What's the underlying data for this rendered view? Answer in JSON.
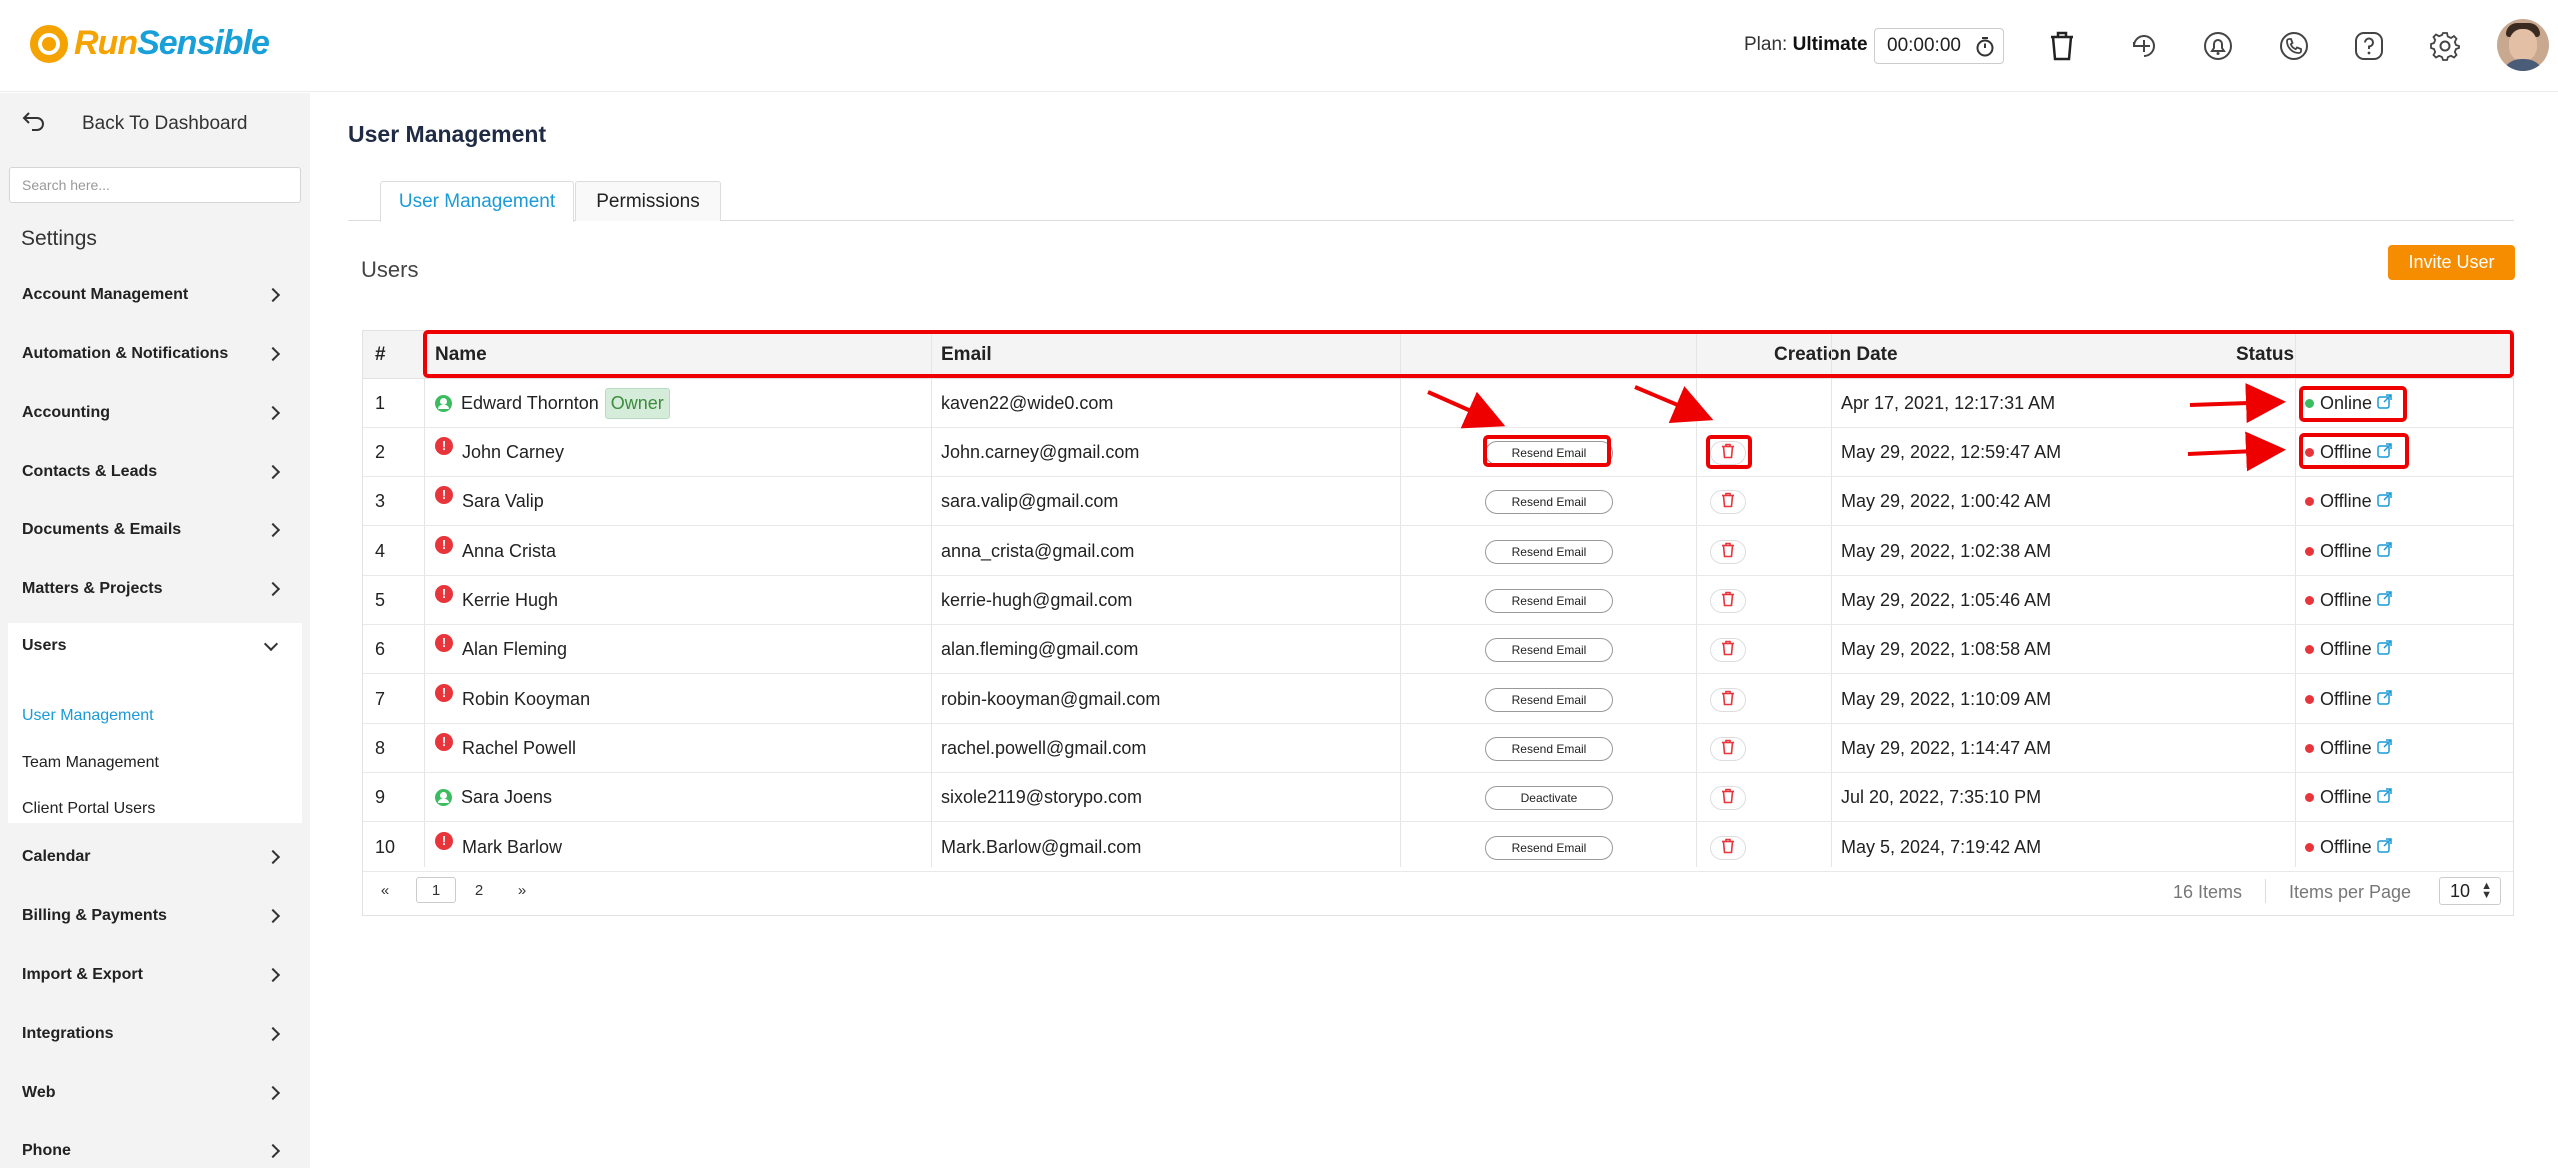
{
  "header": {
    "logo": {
      "part1": "Run",
      "part2": "Sensible"
    },
    "plan_label": "Plan: ",
    "plan_value": "Ultimate",
    "timer": "00:00:00",
    "icons": [
      "trash-icon",
      "add-time-icon",
      "bell-icon",
      "phone-icon",
      "help-icon",
      "gear-icon"
    ]
  },
  "sidebar": {
    "back_label": "Back To Dashboard",
    "search_placeholder": "Search here...",
    "section_title": "Settings",
    "items": [
      {
        "label": "Account Management"
      },
      {
        "label": "Automation & Notifications"
      },
      {
        "label": "Accounting"
      },
      {
        "label": "Contacts & Leads"
      },
      {
        "label": "Documents & Emails"
      },
      {
        "label": "Matters & Projects"
      },
      {
        "label": "Users"
      },
      {
        "label": "Calendar"
      },
      {
        "label": "Billing & Payments"
      },
      {
        "label": "Import & Export"
      },
      {
        "label": "Integrations"
      },
      {
        "label": "Web"
      },
      {
        "label": "Phone"
      }
    ],
    "users_sub": [
      "User Management",
      "Team Management",
      "Client Portal Users"
    ]
  },
  "main": {
    "title": "User Management",
    "tabs": [
      {
        "label": "User Management",
        "active": true
      },
      {
        "label": "Permissions",
        "active": false
      }
    ],
    "section_title": "Users",
    "invite_label": "Invite User",
    "table": {
      "headers": [
        "#",
        "Name",
        "Email",
        "",
        "",
        "Creation Date",
        "Status"
      ],
      "rows": [
        {
          "num": "1",
          "name": "Edward Thornton",
          "badge": "Owner",
          "icon": "ok",
          "email": "kaven22@wide0.com",
          "action": "",
          "date": "Apr 17, 2021, 12:17:31 AM",
          "status": "Online"
        },
        {
          "num": "2",
          "name": "John Carney",
          "badge": "",
          "icon": "err",
          "email": "John.carney@gmail.com",
          "action": "Resend Email",
          "date": "May 29, 2022, 12:59:47 AM",
          "status": "Offline"
        },
        {
          "num": "3",
          "name": "Sara Valip",
          "badge": "",
          "icon": "err",
          "email": "sara.valip@gmail.com",
          "action": "Resend Email",
          "date": "May 29, 2022, 1:00:42 AM",
          "status": "Offline"
        },
        {
          "num": "4",
          "name": "Anna Crista",
          "badge": "",
          "icon": "err",
          "email": "anna_crista@gmail.com",
          "action": "Resend Email",
          "date": "May 29, 2022, 1:02:38 AM",
          "status": "Offline"
        },
        {
          "num": "5",
          "name": "Kerrie Hugh",
          "badge": "",
          "icon": "err",
          "email": "kerrie-hugh@gmail.com",
          "action": "Resend Email",
          "date": "May 29, 2022, 1:05:46 AM",
          "status": "Offline"
        },
        {
          "num": "6",
          "name": "Alan Fleming",
          "badge": "",
          "icon": "err",
          "email": "alan.fleming@gmail.com",
          "action": "Resend Email",
          "date": "May 29, 2022, 1:08:58 AM",
          "status": "Offline"
        },
        {
          "num": "7",
          "name": "Robin Kooyman",
          "badge": "",
          "icon": "err",
          "email": "robin-kooyman@gmail.com",
          "action": "Resend Email",
          "date": "May 29, 2022, 1:10:09 AM",
          "status": "Offline"
        },
        {
          "num": "8",
          "name": "Rachel Powell",
          "badge": "",
          "icon": "err",
          "email": "rachel.powell@gmail.com",
          "action": "Resend Email",
          "date": "May 29, 2022, 1:14:47 AM",
          "status": "Offline"
        },
        {
          "num": "9",
          "name": "Sara Joens",
          "badge": "",
          "icon": "ok",
          "email": "sixole2119@storypo.com",
          "action": "Deactivate",
          "date": "Jul 20, 2022, 7:35:10 PM",
          "status": "Offline"
        },
        {
          "num": "10",
          "name": "Mark Barlow",
          "badge": "",
          "icon": "err",
          "email": "Mark.Barlow@gmail.com",
          "action": "Resend Email",
          "date": "May 5, 2024, 7:19:42 AM",
          "status": "Offline"
        }
      ]
    },
    "pagination": {
      "prev": "«",
      "pages": [
        "1",
        "2"
      ],
      "next": "»",
      "items_count": "16 Items",
      "items_per_page_label": "Items per Page",
      "items_per_page": "10"
    }
  },
  "colors": {
    "accent": "#1a9ad6",
    "invite": "#f68d00",
    "online": "#3cbc60",
    "offline": "#e8353b",
    "annotation": "#ee0000"
  }
}
